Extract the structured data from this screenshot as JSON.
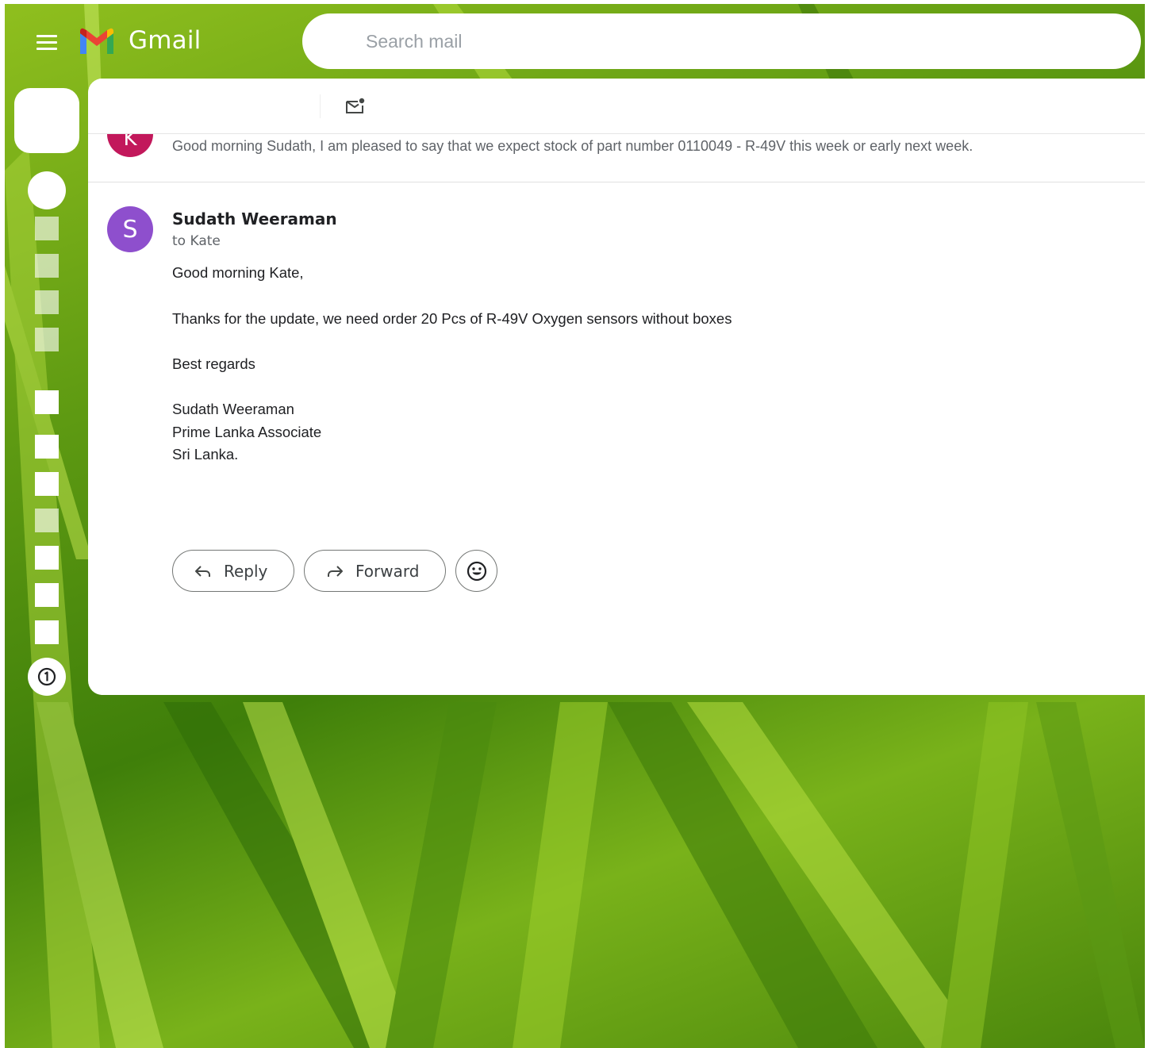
{
  "app": {
    "brand_name": "Gmail"
  },
  "search": {
    "placeholder": "Search mail"
  },
  "thread": {
    "collapsed_message": {
      "avatar_initial": "K",
      "snippet": "Good morning Sudath, I am pleased to say that we expect stock of part number 0110049 - R-49V this week or early next week."
    },
    "open_message": {
      "avatar_initial": "S",
      "sender": "Sudath Weeraman",
      "recipient": "to Kate",
      "body": {
        "greeting": "Good morning Kate,",
        "line1": "Thanks for the update, we need order 20 Pcs of R-49V Oxygen sensors without boxes",
        "closing": "Best regards",
        "signature_name": "Sudath Weeraman",
        "signature_company": "Prime Lanka Associate",
        "signature_country": "Sri Lanka."
      }
    }
  },
  "actions": {
    "reply_label": "Reply",
    "forward_label": "Forward"
  },
  "colors": {
    "avatar_k": "#c2185b",
    "avatar_s": "#8e4fcd",
    "background_green": "#5e9a12"
  },
  "icons": {
    "menu": "hamburger-menu-icon",
    "logo": "gmail-m-logo-icon",
    "mark_unread": "mark-unread-icon",
    "reply": "reply-arrow-icon",
    "forward": "forward-arrow-icon",
    "emoji": "emoji-smile-icon",
    "support": "support-badge-icon"
  }
}
